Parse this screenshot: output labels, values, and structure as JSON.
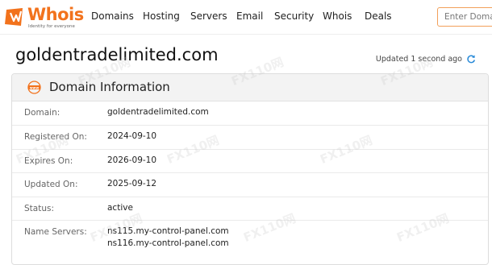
{
  "brand": {
    "name": "Whois",
    "tagline": "Identity for everyone",
    "color": "#f2721c"
  },
  "nav": {
    "items": [
      "Domains",
      "Hosting",
      "Servers",
      "Email",
      "Security",
      "Whois",
      "Deals"
    ]
  },
  "search": {
    "placeholder": "Enter Domain"
  },
  "page": {
    "domain": "goldentradelimited.com",
    "updated_text": "Updated 1 second ago"
  },
  "panel": {
    "title": "Domain Information",
    "icon": "www-icon",
    "rows": [
      {
        "label": "Domain:",
        "value": "goldentradelimited.com"
      },
      {
        "label": "Registered On:",
        "value": "2024-09-10"
      },
      {
        "label": "Expires On:",
        "value": "2026-09-10"
      },
      {
        "label": "Updated On:",
        "value": "2025-09-12"
      },
      {
        "label": "Status:",
        "value": "active"
      },
      {
        "label": "Name Servers:",
        "values": [
          "ns115.my-control-panel.com",
          "ns116.my-control-panel.com"
        ]
      }
    ]
  },
  "watermark": {
    "text": "FX110网"
  }
}
